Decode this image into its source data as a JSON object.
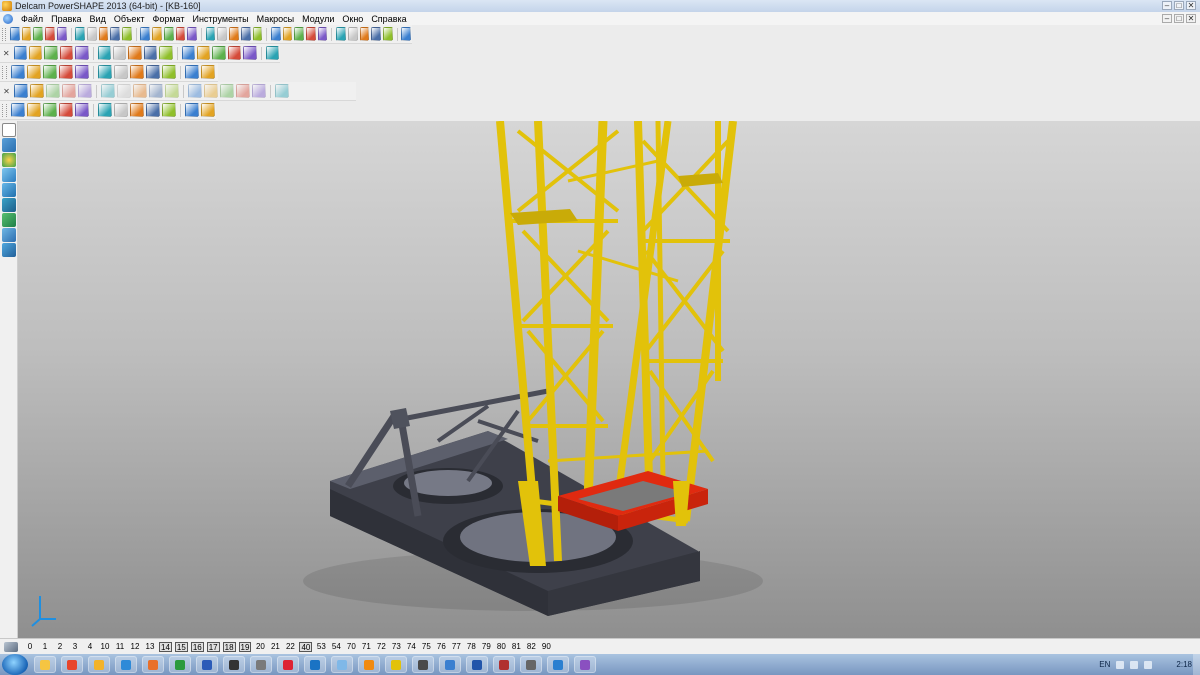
{
  "window": {
    "title": "Delcam PowerSHAPE 2013 (64-bit) - [KB-160]",
    "controls": [
      "–",
      "□",
      "✕"
    ],
    "mdi_controls": [
      "–",
      "□",
      "✕"
    ]
  },
  "menu": [
    "Файл",
    "Правка",
    "Вид",
    "Объект",
    "Формат",
    "Инструменты",
    "Макросы",
    "Модули",
    "Окно",
    "Справка"
  ],
  "colors": {
    "tower": "#e2c20a",
    "tower_shadow": "#9c8208",
    "base": "#3e404a",
    "base_light": "#5c5f6c",
    "red_frame": "#e02a10",
    "axis": "#1f8fe0"
  },
  "toolbars": {
    "main": [
      "open-icon",
      "new-icon",
      "save-icon",
      "print-icon",
      "undo-icon",
      "redo-icon",
      "cut-icon",
      "copy-icon",
      "paste-icon",
      "delete-icon",
      "zoom-icon",
      "zoom-in-icon",
      "zoom-out-icon",
      "zoom-box-icon",
      "view-icon",
      "shading-icon",
      "light-icon",
      "hand-icon",
      "undo-icon",
      "redo-icon",
      "macro-icon",
      "wireframe-icon",
      "select-icon",
      "circle-icon",
      "curve-icon",
      "text-icon",
      "tools-icon",
      "solid-icon",
      "layers-icon",
      "spray-icon",
      "wrench-icon"
    ],
    "row2": [
      "grid-icon",
      "workplane-icon",
      "cube-icon",
      "mesh-icon",
      "sphere-icon",
      "play-icon",
      "arrow-icon",
      "cube2-icon",
      "solid-view-icon",
      "info-icon",
      "import-icon",
      "export-icon"
    ],
    "row3": [
      "smart-icon",
      "pick-icon",
      "solid-a-icon",
      "solid-b-icon",
      "solid-c-icon",
      "fillet-icon",
      "chamfer-icon",
      "shell-icon",
      "boolean-icon",
      "cut-solid-icon",
      "extrude-icon",
      "revolve-icon",
      "sweep-icon",
      "loft-icon",
      "feature-icon",
      "tree-icon"
    ],
    "row4": [
      "sphere-small-icon",
      "axis-icon",
      "cylinder-icon",
      "cone-icon",
      "box-icon",
      "torus-icon",
      "plate-icon",
      "block-icon",
      "edit-icon",
      "gear-icon",
      "star-icon",
      "pyramid-icon"
    ]
  },
  "levels": [
    {
      "n": "0",
      "on": false
    },
    {
      "n": "1",
      "on": false
    },
    {
      "n": "2",
      "on": false
    },
    {
      "n": "3",
      "on": false
    },
    {
      "n": "4",
      "on": false
    },
    {
      "n": "10",
      "on": false
    },
    {
      "n": "11",
      "on": false
    },
    {
      "n": "12",
      "on": false
    },
    {
      "n": "13",
      "on": false
    },
    {
      "n": "14",
      "on": true
    },
    {
      "n": "15",
      "on": true
    },
    {
      "n": "16",
      "on": true
    },
    {
      "n": "17",
      "on": true
    },
    {
      "n": "18",
      "on": true
    },
    {
      "n": "19",
      "on": true
    },
    {
      "n": "20",
      "on": false
    },
    {
      "n": "21",
      "on": false
    },
    {
      "n": "22",
      "on": false
    },
    {
      "n": "40",
      "on": true
    },
    {
      "n": "53",
      "on": false
    },
    {
      "n": "54",
      "on": false
    },
    {
      "n": "70",
      "on": false
    },
    {
      "n": "71",
      "on": false
    },
    {
      "n": "72",
      "on": false
    },
    {
      "n": "73",
      "on": false
    },
    {
      "n": "74",
      "on": false
    },
    {
      "n": "75",
      "on": false
    },
    {
      "n": "76",
      "on": false
    },
    {
      "n": "77",
      "on": false
    },
    {
      "n": "78",
      "on": false
    },
    {
      "n": "79",
      "on": false
    },
    {
      "n": "80",
      "on": false
    },
    {
      "n": "81",
      "on": false
    },
    {
      "n": "82",
      "on": false
    },
    {
      "n": "90",
      "on": false
    }
  ],
  "taskbar": {
    "apps": [
      "explorer-icon",
      "chrome-icon",
      "folder-icon",
      "media-icon",
      "firefox-icon",
      "excel-icon",
      "word-icon",
      "terminal-icon",
      "calculator-icon",
      "paint-icon",
      "photoshop-icon",
      "notepad-icon",
      "vlc-icon",
      "powershape-icon",
      "app-icon",
      "app2-icon",
      "save-app-icon",
      "game-icon",
      "app3-icon",
      "app4-icon",
      "app5-icon"
    ],
    "lang": "EN",
    "clock": "2:18"
  }
}
